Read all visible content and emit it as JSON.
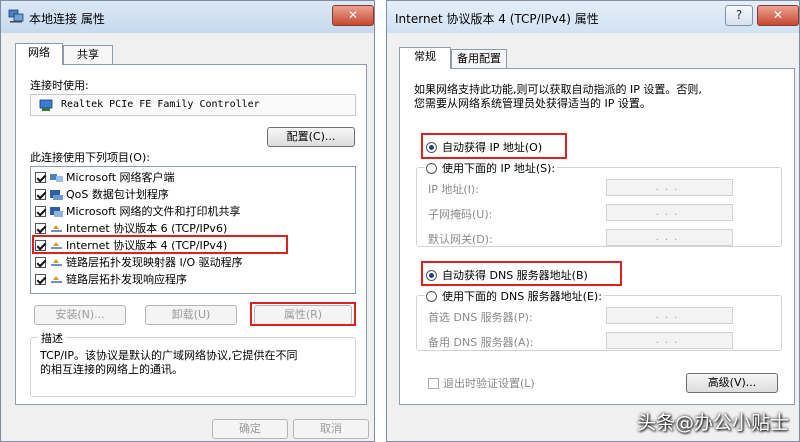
{
  "left_dialog": {
    "title": "本地连接 属性",
    "close_label": "✕",
    "tabs": [
      {
        "label": "网络"
      },
      {
        "label": "共享"
      }
    ],
    "connect_using_label": "连接时使用:",
    "adapter_name": "Realtek PCIe FE Family Controller",
    "configure_button": "配置(C)...",
    "items_label": "此连接使用下列项目(O):",
    "items": [
      {
        "label": "Microsoft 网络客户端",
        "checked": true
      },
      {
        "label": "QoS 数据包计划程序",
        "checked": true
      },
      {
        "label": "Microsoft 网络的文件和打印机共享",
        "checked": true
      },
      {
        "label": "Internet 协议版本 6 (TCP/IPv6)",
        "checked": true
      },
      {
        "label": "Internet 协议版本 4 (TCP/IPv4)",
        "checked": true
      },
      {
        "label": "链路层拓扑发现映射器 I/O 驱动程序",
        "checked": true
      },
      {
        "label": "链路层拓扑发现响应程序",
        "checked": true
      }
    ],
    "install_button": "安装(N)...",
    "uninstall_button": "卸载(U)",
    "properties_button": "属性(R)",
    "description_title": "描述",
    "description_line1": "TCP/IP。该协议是默认的广域网络协议,它提供在不同",
    "description_line2": "的相互连接的网络上的通讯。",
    "ok_button": "确定",
    "cancel_button": "取消"
  },
  "right_dialog": {
    "title": "Internet 协议版本 4 (TCP/IPv4) 属性",
    "help_label": "?",
    "close_label": "✕",
    "tabs": [
      {
        "label": "常规"
      },
      {
        "label": "备用配置"
      }
    ],
    "intro_line1": "如果网络支持此功能,则可以获取自动指派的 IP 设置。否则,",
    "intro_line2": "您需要从网络系统管理员处获得适当的 IP 设置。",
    "auto_ip": "自动获得 IP 地址(O)",
    "manual_ip": "使用下面的 IP 地址(S):",
    "ip_address_label": "IP 地址(I):",
    "subnet_label": "子网掩码(U):",
    "gateway_label": "默认网关(D):",
    "auto_dns": "自动获得 DNS 服务器地址(B)",
    "manual_dns": "使用下面的 DNS 服务器地址(E):",
    "preferred_dns_label": "首选 DNS 服务器(P):",
    "alternate_dns_label": "备用 DNS 服务器(A):",
    "field_placeholder": "...",
    "validate_label": "退出时验证设置(L)",
    "advanced_button": "高级(V)..."
  },
  "watermark": "头条@办公小贴士",
  "colors": {
    "highlight": "#e02020",
    "radio_dot": "#1d3f8a",
    "title_bar": "#c6d9ee"
  }
}
